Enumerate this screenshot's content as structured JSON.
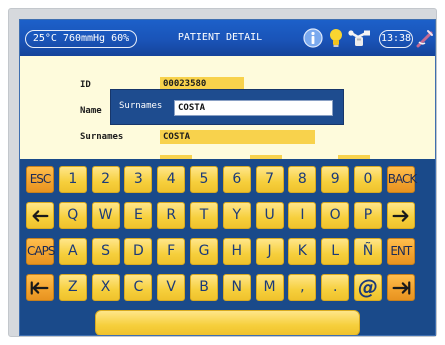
{
  "status": {
    "environment": "25°C 760mmHg 60%",
    "title": "PATIENT DETAIL",
    "clock": "13:38",
    "icons": [
      "info-icon",
      "bulb-icon",
      "usb-icon",
      "power-icon"
    ]
  },
  "form": {
    "id_label": "ID",
    "id_value": "00023580",
    "name_label": "Name",
    "surnames_label": "Surnames",
    "surnames_value": "COSTA"
  },
  "editor": {
    "label": "Surnames",
    "value": "COSTA"
  },
  "keyboard": {
    "rows": [
      [
        "ESC",
        "1",
        "2",
        "3",
        "4",
        "5",
        "6",
        "7",
        "8",
        "9",
        "0",
        "BACK"
      ],
      [
        "left-arrow-icon",
        "Q",
        "W",
        "E",
        "R",
        "T",
        "Y",
        "U",
        "I",
        "O",
        "P",
        "right-arrow-icon"
      ],
      [
        "CAPS",
        "A",
        "S",
        "D",
        "F",
        "G",
        "H",
        "J",
        "K",
        "L",
        "Ñ",
        "ENT"
      ],
      [
        "home-arrow-icon",
        "Z",
        "X",
        "C",
        "V",
        "B",
        "N",
        "M",
        ",",
        ".",
        "@",
        "end-arrow-icon"
      ]
    ],
    "special_keys": [
      "ESC",
      "BACK",
      "CAPS",
      "ENT",
      "home-arrow-icon",
      "end-arrow-icon"
    ],
    "space": "space-bar"
  },
  "colors": {
    "status_bar": "#1a54b8",
    "screen_bg": "#fefbdc",
    "key_yellow": "#f6cf3c",
    "key_orange": "#f2a22e",
    "keyboard_bg": "#1a4a8a",
    "editor_bg": "#1e4c8f"
  }
}
